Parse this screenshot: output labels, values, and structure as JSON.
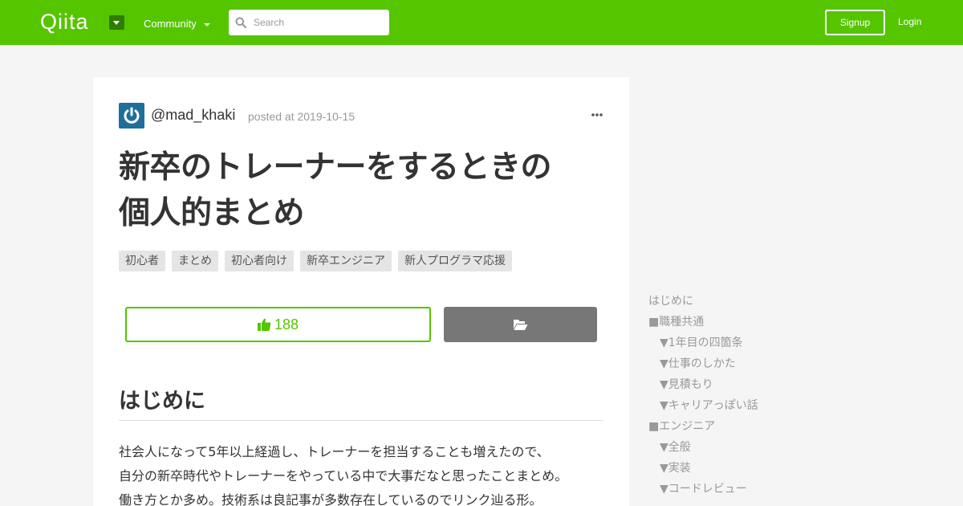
{
  "header": {
    "logo": "Qiita",
    "community_label": "Community",
    "search_placeholder": "Search",
    "signup_label": "Signup",
    "login_label": "Login"
  },
  "article": {
    "username": "@mad_khaki",
    "posted": "posted at 2019-10-15",
    "title_line1": "新卒のトレーナーをするときの",
    "title_line2": "個人的まとめ",
    "tags": [
      "初心者",
      "まとめ",
      "初心者向け",
      "新卒エンジニア",
      "新人プログラマ応援"
    ],
    "likes": "188",
    "section_heading": "はじめに",
    "paragraph": [
      "社会人になって5年以上経過し、トレーナーを担当することも増えたので、",
      "自分の新卒時代やトレーナーをやっている中で大事だなと思ったことまとめ。",
      "働き方とか多め。技術系は良記事が多数存在しているのでリンク辿る形。"
    ]
  },
  "toc": [
    {
      "label": "はじめに",
      "level": 1
    },
    {
      "label": "■職種共通",
      "level": 1
    },
    {
      "label": "▼1年目の四箇条",
      "level": 2
    },
    {
      "label": "▼仕事のしかた",
      "level": 2
    },
    {
      "label": "▼見積もり",
      "level": 2
    },
    {
      "label": "▼キャリアっぽい話",
      "level": 2
    },
    {
      "label": "■エンジニア",
      "level": 1
    },
    {
      "label": "▼全般",
      "level": 2
    },
    {
      "label": "▼実装",
      "level": 2
    },
    {
      "label": "▼コードレビュー",
      "level": 2
    }
  ],
  "colors": {
    "brand": "#55c500",
    "stock_button": "#777777",
    "avatar": "#1f6f9c"
  },
  "icons": [
    "search-icon",
    "caret-down-icon",
    "thumbs-up-icon",
    "folder-open-icon",
    "more-dots-icon",
    "power-icon"
  ]
}
